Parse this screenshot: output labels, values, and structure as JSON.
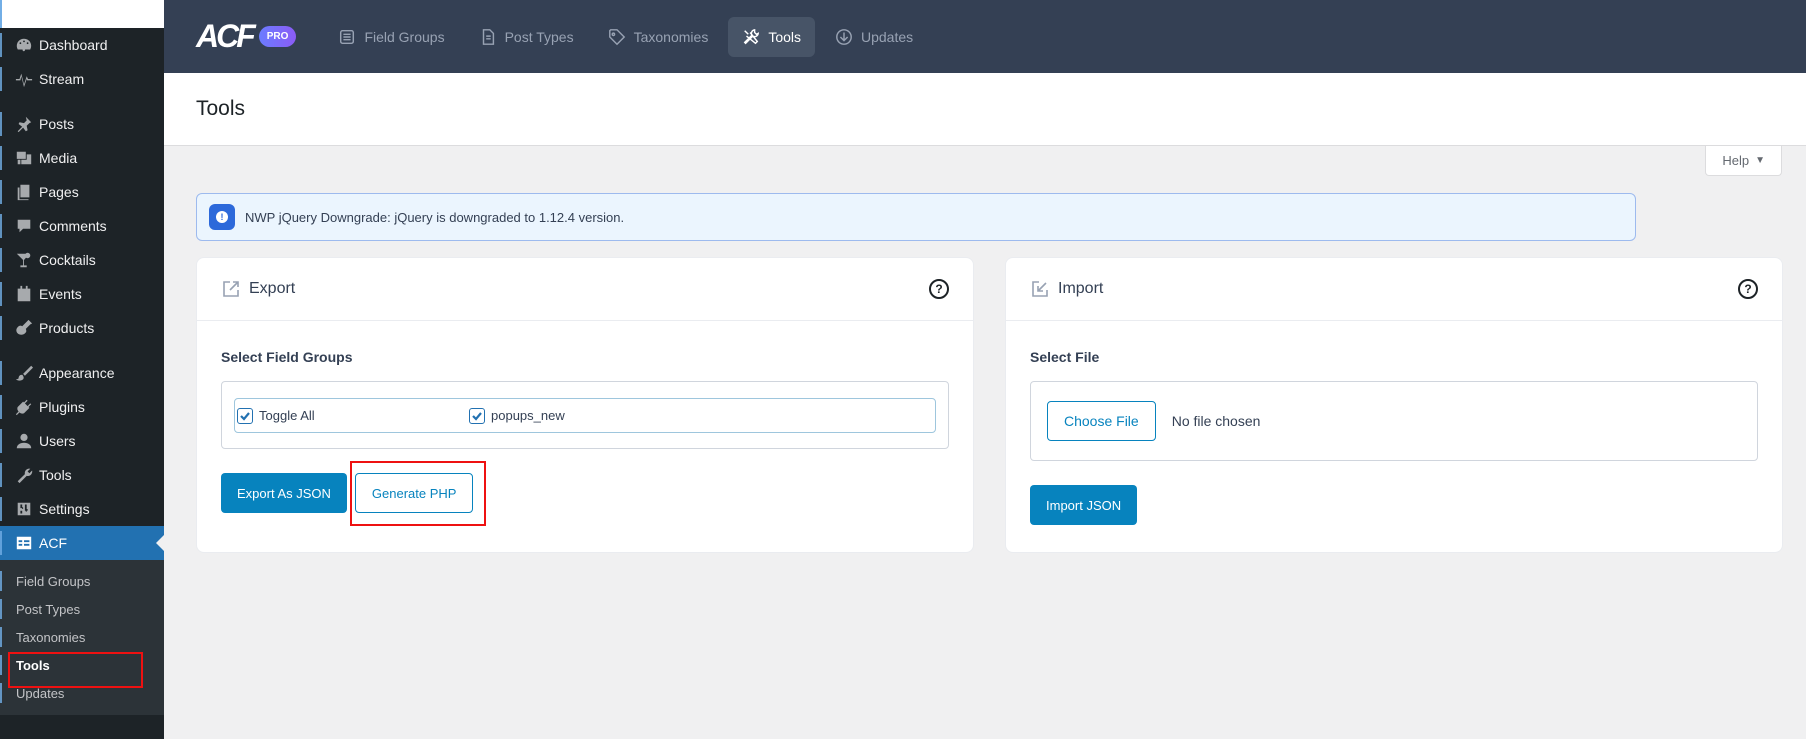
{
  "sidebar": {
    "items": [
      {
        "label": "Dashboard",
        "icon": "dashboard-icon"
      },
      {
        "label": "Stream",
        "icon": "stream-icon"
      },
      {
        "label": "Posts",
        "icon": "pin-icon"
      },
      {
        "label": "Media",
        "icon": "media-icon"
      },
      {
        "label": "Pages",
        "icon": "pages-icon"
      },
      {
        "label": "Comments",
        "icon": "comment-icon"
      },
      {
        "label": "Cocktails",
        "icon": "cocktail-icon"
      },
      {
        "label": "Events",
        "icon": "calendar-icon"
      },
      {
        "label": "Products",
        "icon": "guitar-icon"
      },
      {
        "label": "Appearance",
        "icon": "brush-icon"
      },
      {
        "label": "Plugins",
        "icon": "plugin-icon"
      },
      {
        "label": "Users",
        "icon": "user-icon"
      },
      {
        "label": "Tools",
        "icon": "wrench-icon"
      },
      {
        "label": "Settings",
        "icon": "settings-icon"
      },
      {
        "label": "ACF",
        "icon": "acf-table-icon"
      }
    ],
    "submenu": [
      "Field Groups",
      "Post Types",
      "Taxonomies",
      "Tools",
      "Updates"
    ]
  },
  "header": {
    "logo_text": "ACF",
    "pro_badge": "PRO",
    "tabs": [
      {
        "label": "Field Groups",
        "icon": "field-groups-icon"
      },
      {
        "label": "Post Types",
        "icon": "post-types-icon"
      },
      {
        "label": "Taxonomies",
        "icon": "tag-icon"
      },
      {
        "label": "Tools",
        "icon": "tools-icon"
      },
      {
        "label": "Updates",
        "icon": "download-circle-icon"
      }
    ]
  },
  "page": {
    "title": "Tools",
    "help_label": "Help"
  },
  "notice": {
    "text": "NWP jQuery Downgrade: jQuery is downgraded to 1.12.4 version."
  },
  "export": {
    "title": "Export",
    "help_glyph": "?",
    "field_label": "Select Field Groups",
    "checkboxes": [
      "Toggle All",
      "popups_new"
    ],
    "export_json_label": "Export As JSON",
    "generate_php_label": "Generate PHP"
  },
  "import": {
    "title": "Import",
    "help_glyph": "?",
    "field_label": "Select File",
    "choose_file_label": "Choose File",
    "file_status": "No file chosen",
    "import_json_label": "Import JSON"
  },
  "colors": {
    "sidebar_bg": "#1d2327",
    "header_bg": "#344054",
    "accent": "#0783be",
    "current_menu": "#2271b1",
    "highlight": "#ee1111"
  }
}
